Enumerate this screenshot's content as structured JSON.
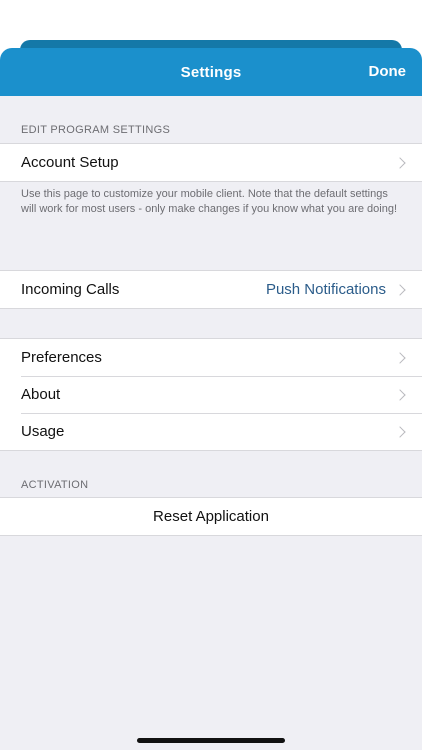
{
  "navbar": {
    "title": "Settings",
    "done_label": "Done"
  },
  "sections": {
    "edit": {
      "header": "EDIT PROGRAM SETTINGS",
      "account_setup": "Account Setup",
      "note": "Use this page to customize your mobile client. Note that the default settings will work for most users - only make changes if you know what you are doing!"
    },
    "calls": {
      "incoming_label": "Incoming Calls",
      "incoming_value": "Push Notifications"
    },
    "general": {
      "preferences": "Preferences",
      "about": "About",
      "usage": "Usage"
    },
    "activation": {
      "header": "ACTIVATION",
      "reset": "Reset Application"
    }
  },
  "colors": {
    "navbar": "#1b90cc",
    "background": "#efeff4",
    "value_text": "#2b5c8a"
  },
  "icons": {
    "disclosure": "chevron-right-icon"
  }
}
